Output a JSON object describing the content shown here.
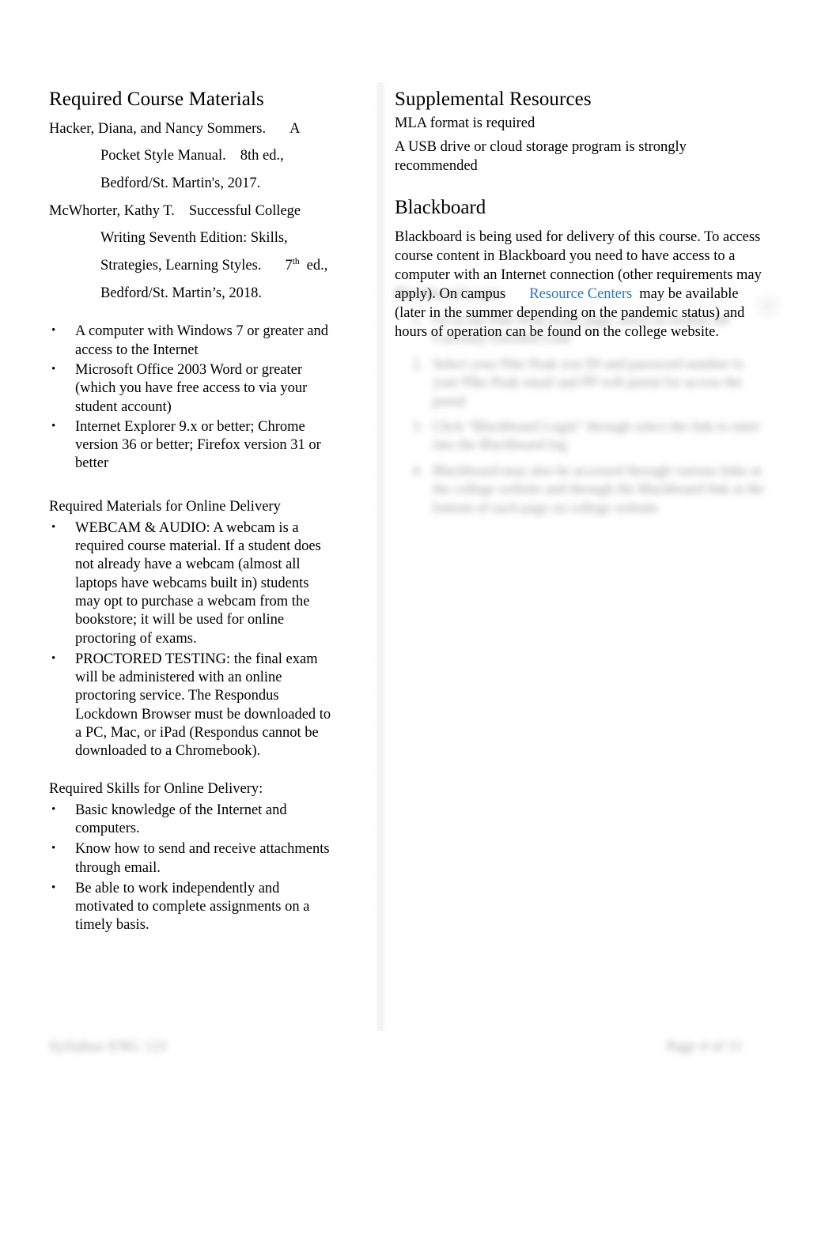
{
  "document": {
    "title": "Required Course Materials"
  },
  "left_column": {
    "heading": "Required Course Materials",
    "citations": [
      {
        "author_line": "Hacker, Diana, and Nancy Sommers.",
        "trailing": "A",
        "lines": [
          {
            "text": "Pocket Style Manual.",
            "trailing": "8th ed.,"
          },
          {
            "text": "Bedford/St. Martin's, 2017.",
            "trailing": ""
          }
        ]
      },
      {
        "author_line": "McWhorter, Kathy T.",
        "trailing": "Successful College",
        "lines": [
          {
            "text": "Writing Seventh Edition: Skills,",
            "trailing": ""
          },
          {
            "text": "Strategies, Learning Styles.",
            "trailing_ordinal": "7",
            "trailing_sup": "th",
            "trailing_rest": "ed.,"
          },
          {
            "text": "Bedford/St. Martin’s, 2018.",
            "trailing": ""
          }
        ]
      }
    ],
    "requirements_bullets": [
      "A computer with Windows 7 or greater and access to the Internet",
      "Microsoft Office 2003 Word or greater (which you have free access to via your student account)",
      "Internet Explorer 9.x or better; Chrome version 36 or better; Firefox version 31 or better"
    ],
    "online_delivery": {
      "label": "Required Materials for Online Delivery",
      "bullets": [
        "WEBCAM & AUDIO:  A webcam is a required course material.      If a student does not already have a webcam (almost all laptops have webcams built in) students may opt to purchase a webcam from the bookstore; it will be used for online proctoring of exams.",
        "PROCTORED TESTING: the final exam will be administered with an online proctoring service. The Respondus Lockdown Browser must be downloaded to a PC, Mac, or iPad (Respondus cannot be downloaded to a Chromebook)."
      ]
    },
    "online_skills": {
      "label": "Required Skills for Online Delivery:",
      "bullets": [
        "Basic knowledge of the Internet and computers.",
        "Know how to send and receive attachments through email.",
        "Be able to work independently and motivated to complete assignments on a timely basis."
      ]
    }
  },
  "right_column": {
    "supplemental": {
      "heading": "Supplemental Resources",
      "line_1": "MLA format is required",
      "line_2": "A USB drive or cloud storage program is strongly recommended"
    },
    "blackboard": {
      "heading": "Blackboard",
      "paragraph_part_1": "Blackboard is being used for delivery of this course. To access course content in Blackboard you need to have access to a computer with an Internet connection (other requirements may apply). On campus",
      "link_text_1": "Resource",
      "link_text_2": "Centers",
      "paragraph_part_2": "may be available (later in the summer depending on the pandemic status) and hours of operation can be found on the college website."
    },
    "redacted_block": {
      "title": "Blackboard Login",
      "items": [
        "Go to the Pike Peak home page, select in toolbar the Currently Enrolled Link",
        "Select your Pike Peak you ID and password number to your Pike Peak email and PP web portal for access the portal",
        "Click “Blackboard Login” through select the link to enter into the Blackboard log",
        "Blackboard may also be accessed through various links at the college website and through the Blackboard link at the bottom of each page on college website"
      ]
    }
  },
  "footer": {
    "left_text": "Syllabus    ENG 121",
    "right_text": "Page 4 of 11"
  },
  "colors": {
    "link": "#2a74c4",
    "text": "#000000",
    "page_background": "#ffffff",
    "divider": "#f3f3f3"
  }
}
